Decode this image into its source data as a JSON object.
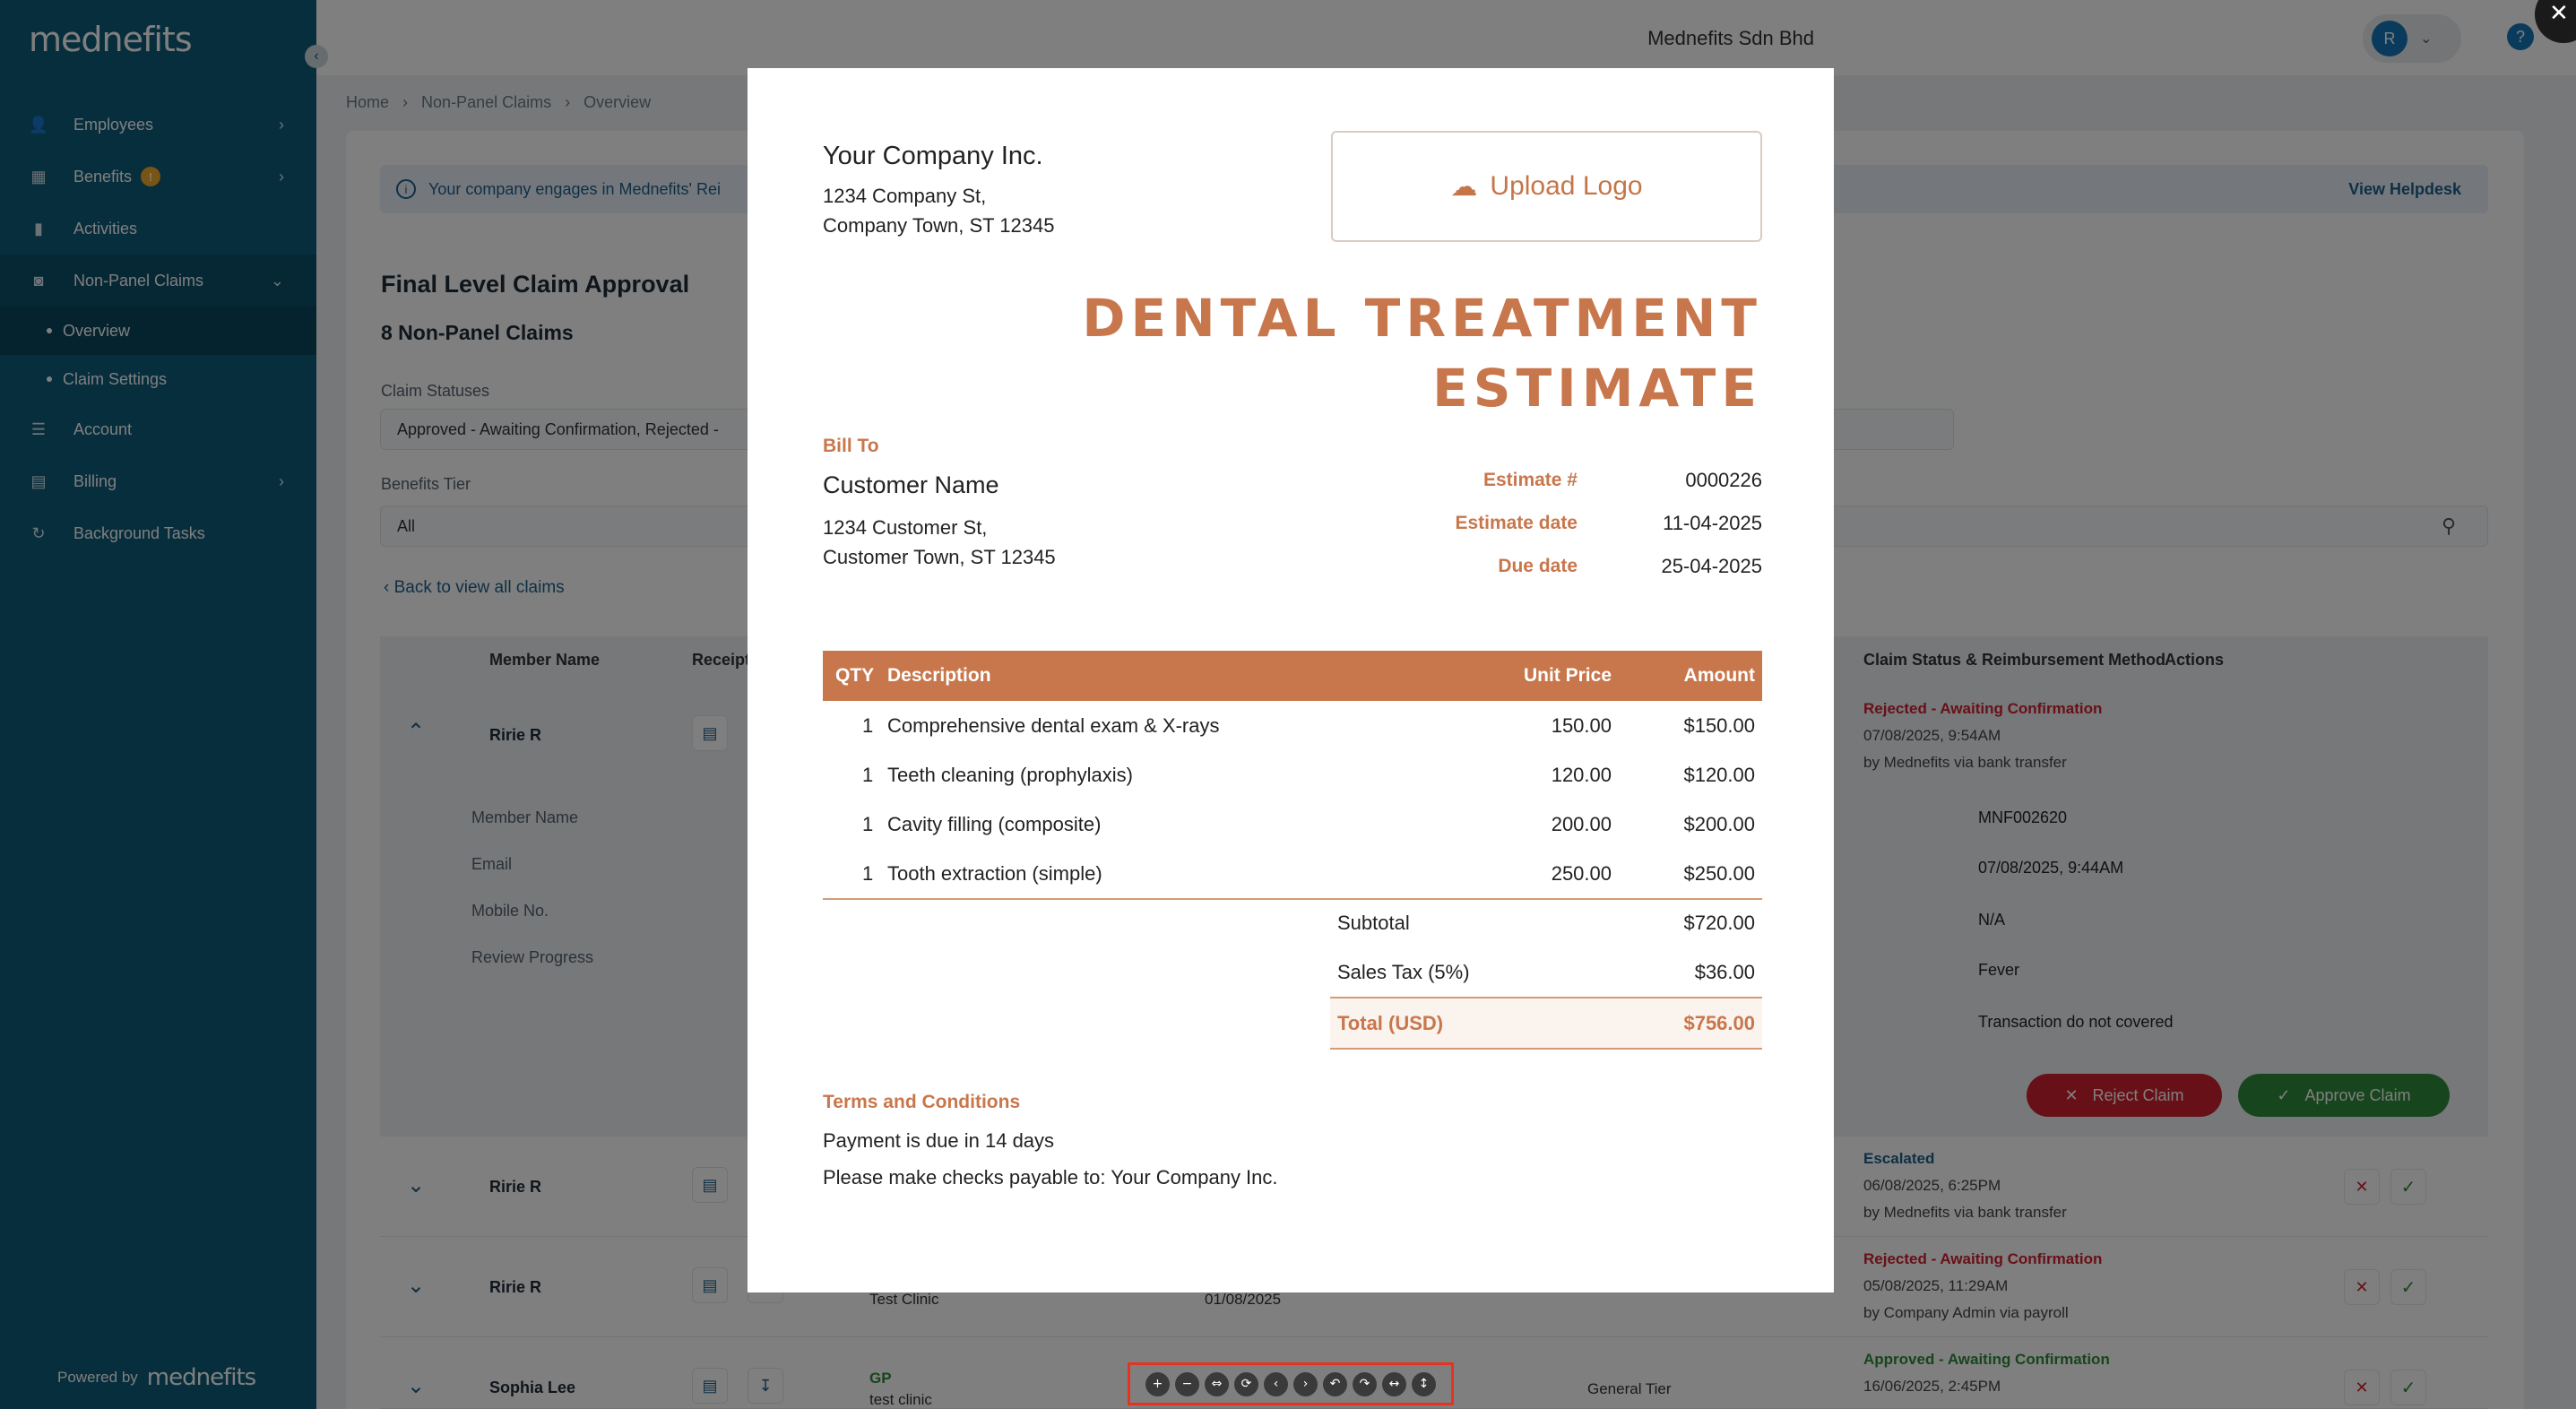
{
  "sidebar": {
    "logo": "mednefits",
    "collapse_icon": "‹",
    "items": [
      {
        "label": "Employees",
        "icon": "👤",
        "chevron": "›"
      },
      {
        "label": "Benefits",
        "icon": "▦",
        "badge": "!",
        "chevron": "›"
      },
      {
        "label": "Activities",
        "icon": "▮",
        "chevron": ""
      },
      {
        "label": "Non-Panel Claims",
        "icon": "◙",
        "chevron": "⌄"
      },
      {
        "label": "Account",
        "icon": "☰",
        "chevron": ""
      },
      {
        "label": "Billing",
        "icon": "▤",
        "chevron": "›"
      },
      {
        "label": "Background Tasks",
        "icon": "↻",
        "chevron": ""
      }
    ],
    "sub_items": [
      {
        "label": "Overview"
      },
      {
        "label": "Claim Settings"
      }
    ],
    "powered_by": "Powered by",
    "powered_logo": "mednefits"
  },
  "topbar": {
    "company": "Mednefits Sdn Bhd",
    "avatar_initial": "R",
    "caret": "⌄",
    "help": "?",
    "close": "✕"
  },
  "breadcrumb": [
    "Home",
    "›",
    "Non-Panel Claims",
    "›",
    "Overview"
  ],
  "banner": {
    "icon": "i",
    "text": "Your company engages in Mednefits' Rei",
    "link": "View Helpdesk"
  },
  "page": {
    "title": "Final Level Claim Approval",
    "count": "8 Non-Panel Claims",
    "claim_status_label": "Claim Statuses",
    "claim_status_value": "Approved - Awaiting Confirmation, Rejected -",
    "benefits_tier_label": "Benefits Tier",
    "benefits_tier_value": "All",
    "back_link": "‹  Back to view all claims"
  },
  "table": {
    "headers": [
      "Member Name",
      "Receipt",
      "Claim Status & Reimbursement Method",
      "Actions"
    ],
    "expanded": {
      "member": "Ririe R",
      "status": "Rejected - Awaiting Confirmation",
      "date": "07/08/2025, 9:54AM",
      "method": "by Mednefits via bank transfer",
      "detail_labels": [
        "Member Name",
        "Email",
        "Mobile No.",
        "Review Progress"
      ],
      "detail_values": [
        "MNF002620",
        "07/08/2025, 9:44AM",
        "N/A",
        "Fever",
        "Transaction do not covered"
      ],
      "reject_label": "Reject Claim",
      "approve_label": "Approve Claim"
    },
    "rows": [
      {
        "member": "Ririe R",
        "status": "Escalated",
        "date": "06/08/2025, 6:25PM",
        "method": "by Mednefits via bank transfer"
      },
      {
        "member": "Ririe R",
        "status": "Rejected - Awaiting Confirmation",
        "date": "05/08/2025, 11:29AM",
        "method": "by Company Admin via payroll",
        "clinic": "Test Clinic",
        "visit_date": "01/08/2025"
      },
      {
        "member": "Sophia Lee",
        "status": "Approved - Awaiting Confirmation",
        "date": "16/06/2025, 2:45PM",
        "type": "GP",
        "clinic": "test clinic",
        "tier": "General Tier"
      }
    ]
  },
  "document": {
    "company_name": "Your Company Inc.",
    "company_addr1": "1234 Company St,",
    "company_addr2": "Company Town, ST 12345",
    "upload_label": "Upload Logo",
    "title1": "DENTAL TREATMENT",
    "title2": "ESTIMATE",
    "bill_to": "Bill To",
    "customer_name": "Customer Name",
    "customer_addr1": "1234 Customer St,",
    "customer_addr2": "Customer Town, ST 12345",
    "meta": [
      {
        "k": "Estimate #",
        "v": "0000226"
      },
      {
        "k": "Estimate date",
        "v": "11-04-2025"
      },
      {
        "k": "Due date",
        "v": "25-04-2025"
      }
    ],
    "items_head": {
      "qty": "QTY",
      "desc": "Description",
      "unit": "Unit Price",
      "amount": "Amount"
    },
    "items": [
      {
        "qty": "1",
        "desc": "Comprehensive dental exam & X-rays",
        "unit": "150.00",
        "amount": "$150.00"
      },
      {
        "qty": "1",
        "desc": "Teeth cleaning (prophylaxis)",
        "unit": "120.00",
        "amount": "$120.00"
      },
      {
        "qty": "1",
        "desc": "Cavity filling (composite)",
        "unit": "200.00",
        "amount": "$200.00"
      },
      {
        "qty": "1",
        "desc": "Tooth extraction (simple)",
        "unit": "250.00",
        "amount": "$250.00"
      }
    ],
    "subtotal_label": "Subtotal",
    "subtotal": "$720.00",
    "tax_label": "Sales Tax (5%)",
    "tax": "$36.00",
    "total_label": "Total (USD)",
    "total": "$756.00",
    "terms_label": "Terms and Conditions",
    "terms1": "Payment is due in 14 days",
    "terms2": "Please make checks payable to: Your Company Inc."
  },
  "viewer_toolbar": [
    "+",
    "−",
    "⇔",
    "⟳",
    "‹",
    "›",
    "↶",
    "↷",
    "↔",
    "↕"
  ]
}
